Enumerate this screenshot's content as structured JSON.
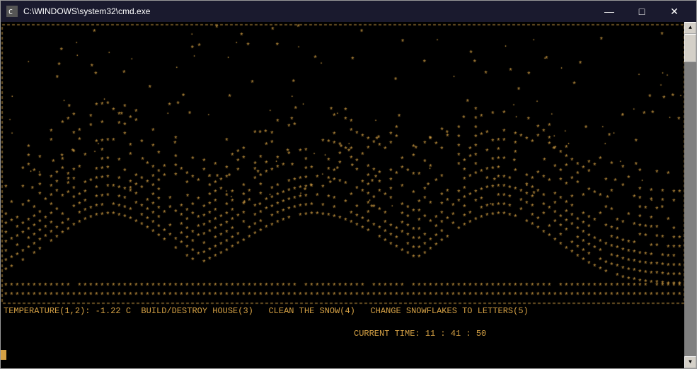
{
  "window": {
    "title": "C:\\WINDOWS\\system32\\cmd.exe",
    "icon": "cmd-icon"
  },
  "controls": {
    "minimize": "—",
    "maximize": "□",
    "close": "✕"
  },
  "status_line1": "TEMPERATURE(1,2): -1.22 C  BUILD/DESTROY HOUSE(3)   CLEAN THE SNOW(4)   CHANGE SNOWFLAKES TO LETTERS(5)",
  "status_line2": "CURRENT TIME: 11 : 41 : 50",
  "colors": {
    "terminal_bg": "#000000",
    "terminal_fg": "#d4a044",
    "titlebar_bg": "#1a1a2e"
  }
}
